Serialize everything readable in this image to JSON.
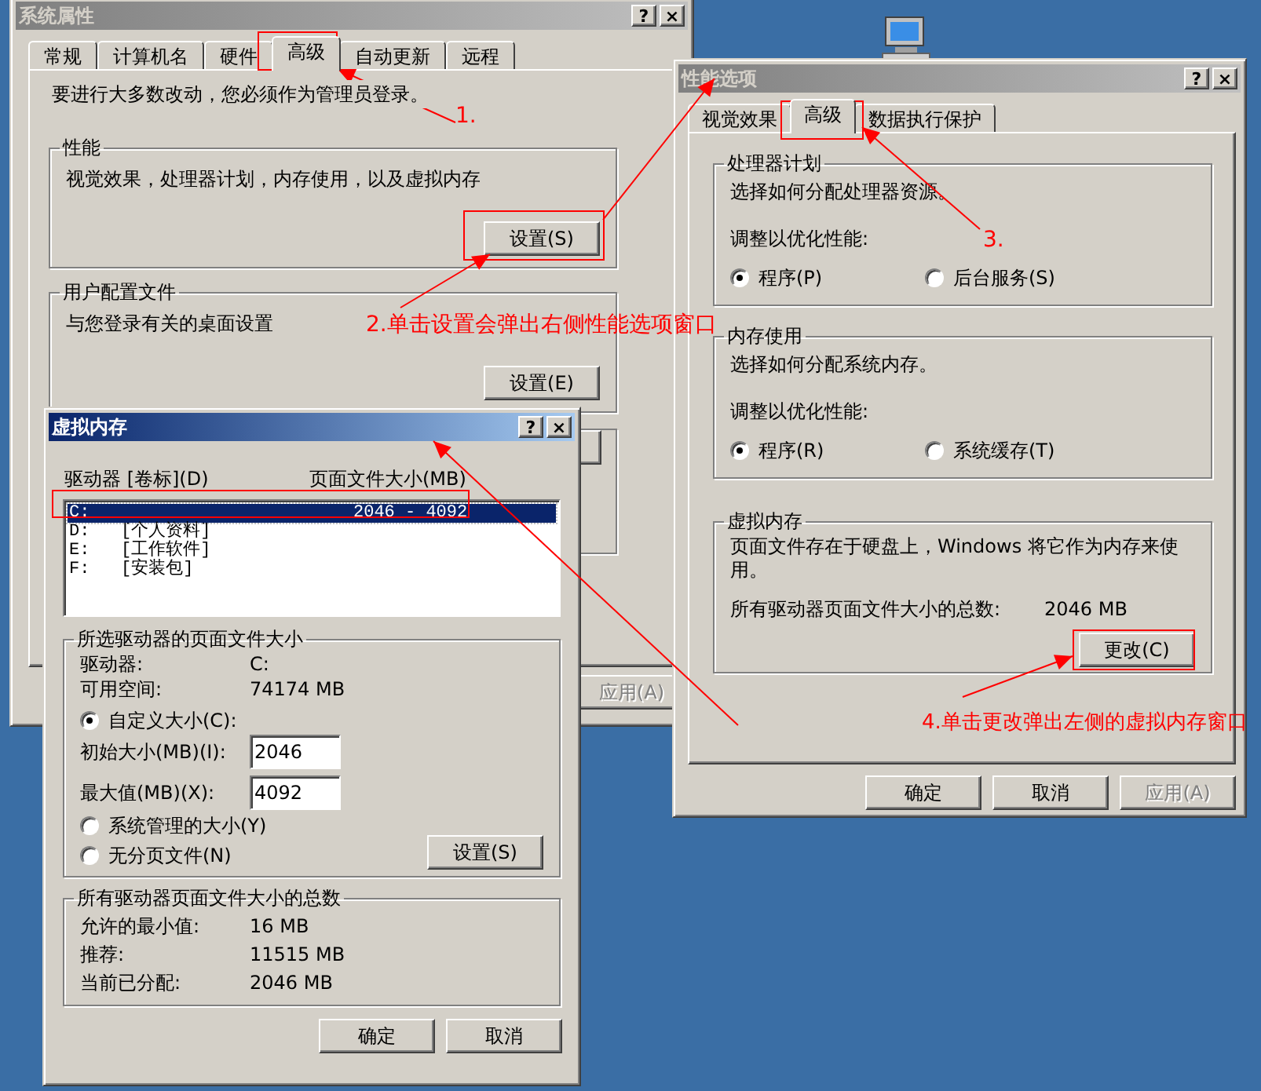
{
  "system_properties": {
    "title": "系统属性",
    "active": false,
    "caption_buttons": [
      "?",
      "×"
    ],
    "tabs": [
      {
        "label": "常规",
        "selected": false
      },
      {
        "label": "计算机名",
        "selected": false
      },
      {
        "label": "硬件",
        "selected": false
      },
      {
        "label": "高级",
        "selected": true
      },
      {
        "label": "自动更新",
        "selected": false
      },
      {
        "label": "远程",
        "selected": false
      }
    ],
    "notice": "要进行大多数改动，您必须作为管理员登录。",
    "groups": [
      {
        "title": "性能",
        "description": "视觉效果，处理器计划，内存使用，以及虚拟内存",
        "button": "设置(S)"
      },
      {
        "title": "用户配置文件",
        "description": "与您登录有关的桌面设置",
        "button": "设置(E)"
      }
    ],
    "buttons": [
      {
        "label": "应用(A)",
        "disabled": true
      }
    ]
  },
  "performance_options": {
    "title": "性能选项",
    "active": false,
    "caption_buttons": [
      "?",
      "×"
    ],
    "tabs": [
      {
        "label": "视觉效果",
        "selected": false
      },
      {
        "label": "高级",
        "selected": true
      },
      {
        "label": "数据执行保护",
        "selected": false
      }
    ],
    "groups": [
      {
        "kind": "radio",
        "title": "处理器计划",
        "description": "选择如何分配处理器资源。",
        "prompt": "调整以优化性能:",
        "options": [
          {
            "label": "程序(P)",
            "selected": true
          },
          {
            "label": "后台服务(S)",
            "selected": false
          }
        ]
      },
      {
        "kind": "radio",
        "title": "内存使用",
        "description": "选择如何分配系统内存。",
        "prompt": "调整以优化性能:",
        "options": [
          {
            "label": "程序(R)",
            "selected": true
          },
          {
            "label": "系统缓存(T)",
            "selected": false
          }
        ]
      },
      {
        "kind": "info",
        "title": "虚拟内存",
        "description": "页面文件存在于硬盘上，Windows 将它作为内存来使用。",
        "total_label": "所有驱动器页面文件大小的总数:",
        "total_value": "2046 MB",
        "button": "更改(C)"
      }
    ],
    "buttons": [
      {
        "label": "确定",
        "disabled": false
      },
      {
        "label": "取消",
        "disabled": false
      },
      {
        "label": "应用(A)",
        "disabled": true
      }
    ]
  },
  "virtual_memory": {
    "title": "虚拟内存",
    "active": true,
    "caption_buttons": [
      "?",
      "×"
    ],
    "columns": [
      "驱动器 [卷标](D)",
      "页面文件大小(MB)"
    ],
    "drives": [
      {
        "drive": "C:",
        "size": "2046 - 4092",
        "selected": true
      },
      {
        "drive": "D:",
        "label": "[个人资料]",
        "selected": false
      },
      {
        "drive": "E:",
        "label": "[工作软件]",
        "selected": false
      },
      {
        "drive": "F:",
        "label": "[安装包]",
        "selected": false
      }
    ],
    "selected_drive": {
      "title": "所选驱动器的页面文件大小",
      "drive_label": "驱动器:",
      "drive_value": "C:",
      "space_label": "可用空间:",
      "space_value": "74174 MB",
      "options": [
        {
          "label": "自定义大小(C):",
          "selected": true
        },
        {
          "label": "系统管理的大小(Y)",
          "selected": false
        },
        {
          "label": "无分页文件(N)",
          "selected": false
        }
      ],
      "initial_label": "初始大小(MB)(I):",
      "initial_value": "2046",
      "max_label": "最大值(MB)(X):",
      "max_value": "4092",
      "button": "设置(S)"
    },
    "totals": {
      "title": "所有驱动器页面文件大小的总数",
      "rows": [
        {
          "label": "允许的最小值:",
          "value": "16 MB"
        },
        {
          "label": "推荐:",
          "value": "11515 MB"
        },
        {
          "label": "当前已分配:",
          "value": "2046 MB"
        }
      ]
    },
    "buttons": [
      "确定",
      "取消"
    ]
  },
  "annotations": [
    {
      "text": "1."
    },
    {
      "text": "2.单击设置会弹出右侧性能选项窗口"
    },
    {
      "text": "3."
    },
    {
      "text": "4.单击更改弹出左侧的虚拟内存窗口"
    }
  ]
}
